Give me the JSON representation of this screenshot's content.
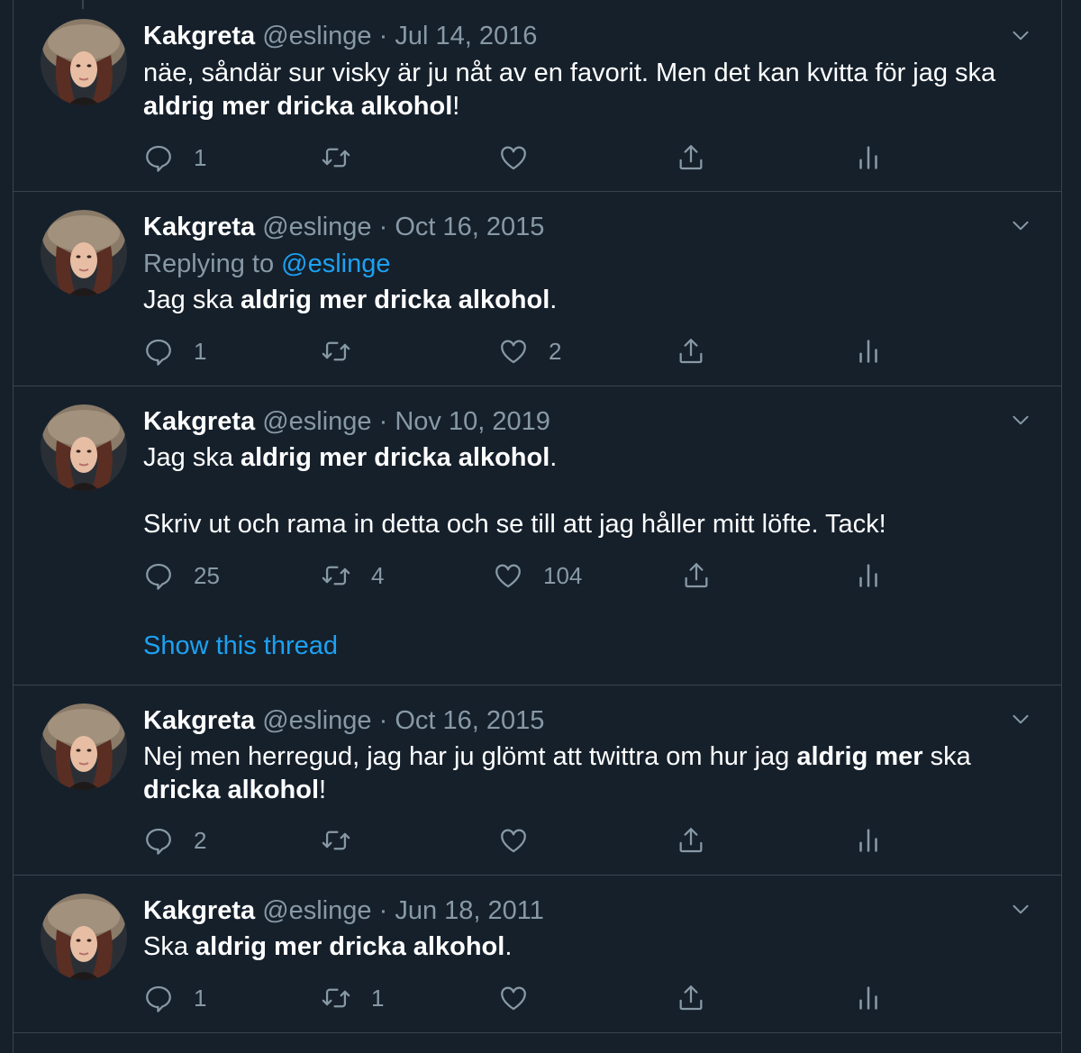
{
  "tweets": [
    {
      "name": "Kakgreta",
      "handle": "@eslinge",
      "dot": "·",
      "date": "Jul 14, 2016",
      "text_before": "näe, såndär sur visky är ju nåt av en favorit. Men det kan kvitta för jag ska ",
      "text_bold": "aldrig mer dricka alkohol",
      "text_after": "!",
      "reply_count": "1",
      "retweet_count": "",
      "like_count": ""
    },
    {
      "name": "Kakgreta",
      "handle": "@eslinge",
      "dot": "·",
      "date": "Oct 16, 2015",
      "replying_label": "Replying to ",
      "replying_to": "@eslinge",
      "text_before": "Jag ska ",
      "text_bold": "aldrig mer dricka alkohol",
      "text_after": ".",
      "reply_count": "1",
      "retweet_count": "",
      "like_count": "2"
    },
    {
      "name": "Kakgreta",
      "handle": "@eslinge",
      "dot": "·",
      "date": "Nov 10, 2019",
      "text_before": "Jag ska ",
      "text_bold": "aldrig mer dricka alkohol",
      "text_after": ".",
      "text_para2": "Skriv ut och rama in detta och se till att jag håller mitt löfte. Tack!",
      "reply_count": "25",
      "retweet_count": "4",
      "like_count": "104",
      "thread_link": "Show this thread"
    },
    {
      "name": "Kakgreta",
      "handle": "@eslinge",
      "dot": "·",
      "date": "Oct 16, 2015",
      "text_before": "Nej men herregud, jag har ju glömt att twittra om hur jag ",
      "text_bold": "aldrig mer",
      "text_middle": " ska ",
      "text_bold2": "dricka alkohol",
      "text_after": "!",
      "reply_count": "2",
      "retweet_count": "",
      "like_count": ""
    },
    {
      "name": "Kakgreta",
      "handle": "@eslinge",
      "dot": "·",
      "date": "Jun 18, 2011",
      "text_before": "Ska ",
      "text_bold": "aldrig mer dricka alkohol",
      "text_after": ".",
      "reply_count": "1",
      "retweet_count": "1",
      "like_count": ""
    }
  ],
  "icons": {
    "reply": "reply-icon",
    "retweet": "retweet-icon",
    "like": "heart-icon",
    "share": "share-icon",
    "analytics": "analytics-icon",
    "caret": "chevron-down-icon"
  },
  "colors": {
    "background": "#15202b",
    "border": "#38444d",
    "secondary_text": "#8899a6",
    "link": "#1da1f2"
  }
}
